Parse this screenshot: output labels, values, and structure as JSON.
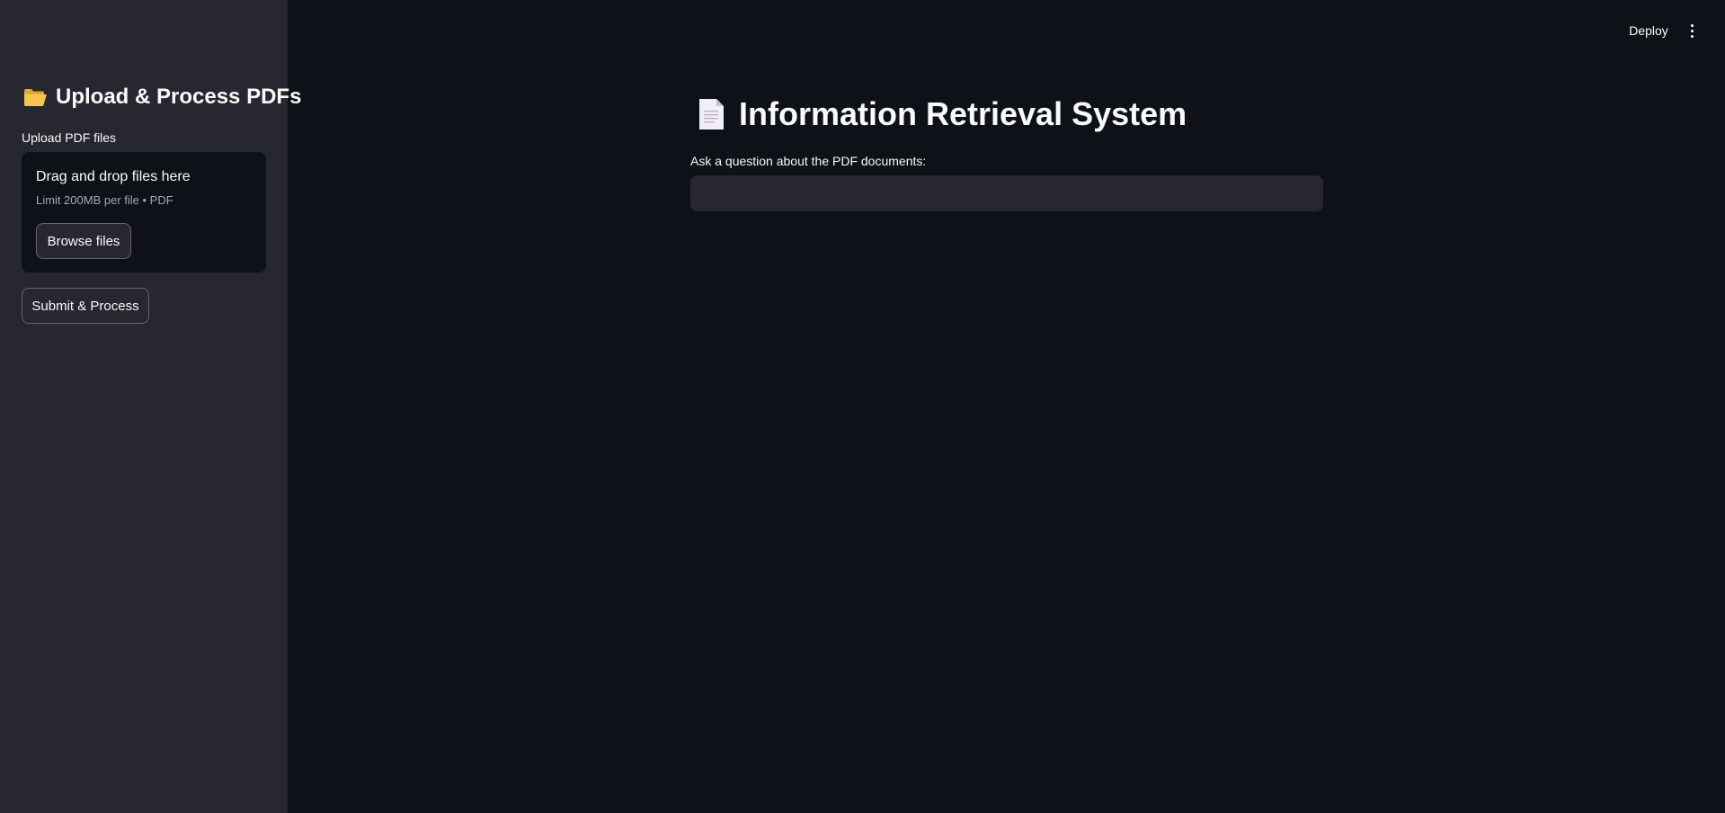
{
  "header": {
    "deploy_label": "Deploy",
    "menu_icon": "kebab-menu-icon"
  },
  "sidebar": {
    "title": "Upload & Process PDFs",
    "title_icon": "folder-icon",
    "upload_label": "Upload PDF files",
    "dropzone": {
      "title": "Drag and drop files here",
      "limit": "Limit 200MB per file • PDF",
      "browse_label": "Browse files"
    },
    "submit_label": "Submit & Process"
  },
  "main": {
    "title": "Information Retrieval System",
    "title_icon": "document-icon",
    "question_label": "Ask a question about the PDF documents:",
    "question_value": "",
    "question_placeholder": ""
  },
  "colors": {
    "background": "#0e1117",
    "sidebar": "#262730",
    "text": "#fafafa",
    "muted_text": "#a3a8b4",
    "folder": "#f5c44d"
  }
}
